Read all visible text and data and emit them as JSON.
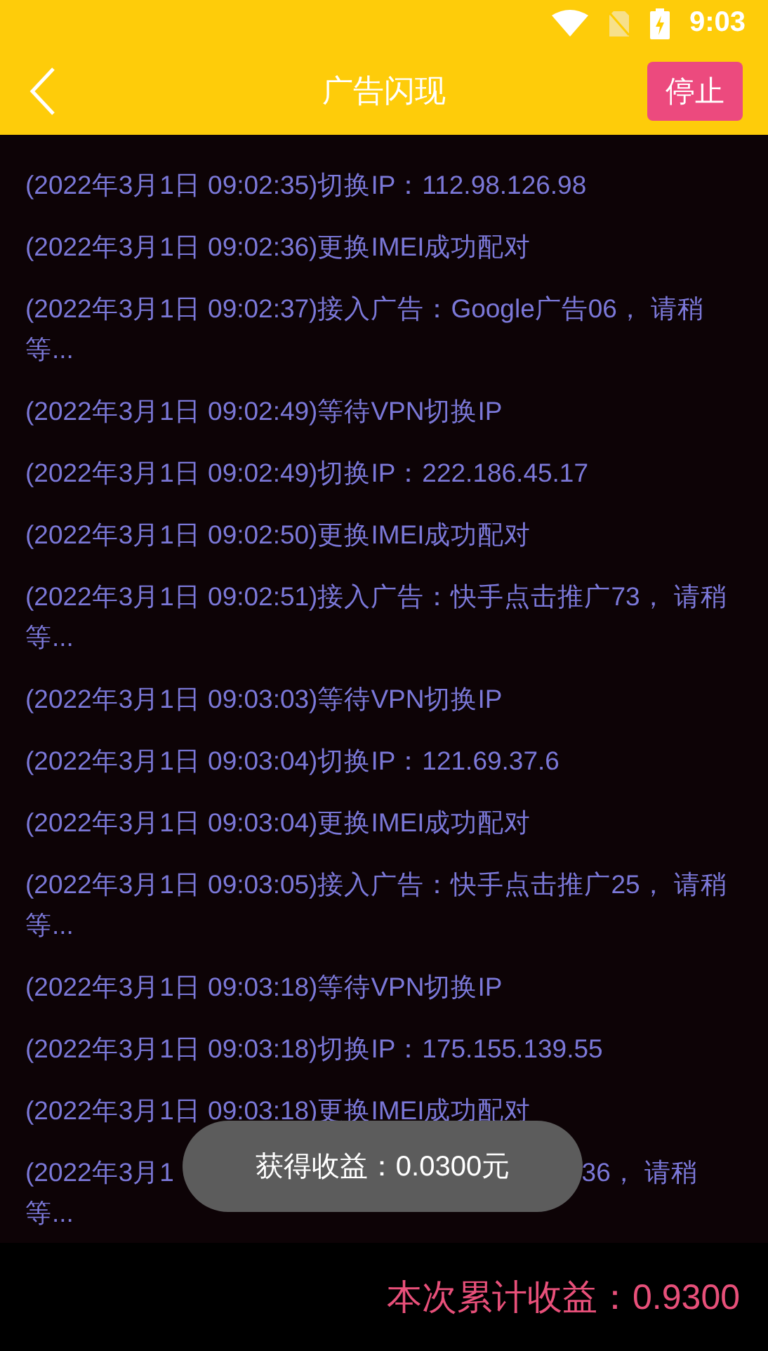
{
  "status_bar": {
    "time": "9:03"
  },
  "app_bar": {
    "title": "广告闪现",
    "stop_button": "停止"
  },
  "log": [
    {
      "kind": "text",
      "text": "(2022年3月1日 09:02:35)切换IP：112.98.126.98"
    },
    {
      "kind": "text",
      "text": "(2022年3月1日 09:02:36)更换IMEI成功配对"
    },
    {
      "kind": "text",
      "text": "(2022年3月1日 09:02:37)接入广告：Google广告06， 请稍等..."
    },
    {
      "kind": "text",
      "text": "(2022年3月1日 09:02:49)等待VPN切换IP"
    },
    {
      "kind": "text",
      "text": "(2022年3月1日 09:02:49)切换IP：222.186.45.17"
    },
    {
      "kind": "text",
      "text": "(2022年3月1日 09:02:50)更换IMEI成功配对"
    },
    {
      "kind": "text",
      "text": "(2022年3月1日 09:02:51)接入广告：快手点击推广73， 请稍等..."
    },
    {
      "kind": "text",
      "text": "(2022年3月1日 09:03:03)等待VPN切换IP"
    },
    {
      "kind": "text",
      "text": "(2022年3月1日 09:03:04)切换IP：121.69.37.6"
    },
    {
      "kind": "text",
      "text": "(2022年3月1日 09:03:04)更换IMEI成功配对"
    },
    {
      "kind": "text",
      "text": "(2022年3月1日 09:03:05)接入广告：快手点击推广25， 请稍等..."
    },
    {
      "kind": "text",
      "text": "(2022年3月1日 09:03:18)等待VPN切换IP"
    },
    {
      "kind": "text",
      "text": "(2022年3月1日 09:03:18)切换IP：175.155.139.55"
    },
    {
      "kind": "text",
      "text": "(2022年3月1日 09:03:18)更换IMEI成功配对"
    },
    {
      "kind": "covered",
      "start": "(2022年3月1",
      "end": "36， 请稍",
      "tail": "等..."
    }
  ],
  "toast": {
    "text": "获得收益：0.0300元"
  },
  "footer": {
    "total": "本次累计收益：0.9300"
  }
}
